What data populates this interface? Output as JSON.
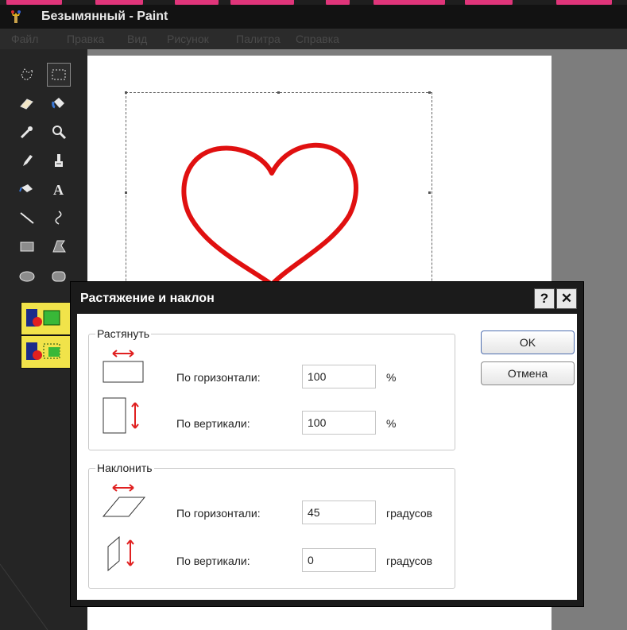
{
  "window": {
    "title": "Безымянный - Paint"
  },
  "menu": [
    "Файл",
    "Правка",
    "Вид",
    "Рисунок",
    "Палитра",
    "Справка"
  ],
  "tools": [
    "free-select-icon",
    "rect-select-icon",
    "eraser-icon",
    "fill-icon",
    "color-picker-icon",
    "magnifier-icon",
    "pencil-icon",
    "brush-icon",
    "airbrush-icon",
    "text-icon",
    "line-icon",
    "curve-icon",
    "rectangle-icon",
    "polygon-icon",
    "ellipse-icon",
    "rounded-rect-icon"
  ],
  "dialog": {
    "title": "Растяжение и наклон",
    "help_label": "?",
    "close_label": "✕",
    "stretch": {
      "legend": "Растянуть",
      "horizontal_label": "По горизонтали:",
      "horizontal_value": "100",
      "horizontal_unit": "%",
      "vertical_label": "По вертикали:",
      "vertical_value": "100",
      "vertical_unit": "%"
    },
    "skew": {
      "legend": "Наклонить",
      "horizontal_label": "По горизонтали:",
      "horizontal_value": "45",
      "horizontal_unit": "градусов",
      "vertical_label": "По вертикали:",
      "vertical_value": "0",
      "vertical_unit": "градусов"
    },
    "ok_label": "OK",
    "cancel_label": "Отмена"
  },
  "colors": {
    "heart": "#e01010",
    "accent_arrow": "#e02020",
    "option_box": "#f1e34a",
    "decor": "#e0357a"
  }
}
